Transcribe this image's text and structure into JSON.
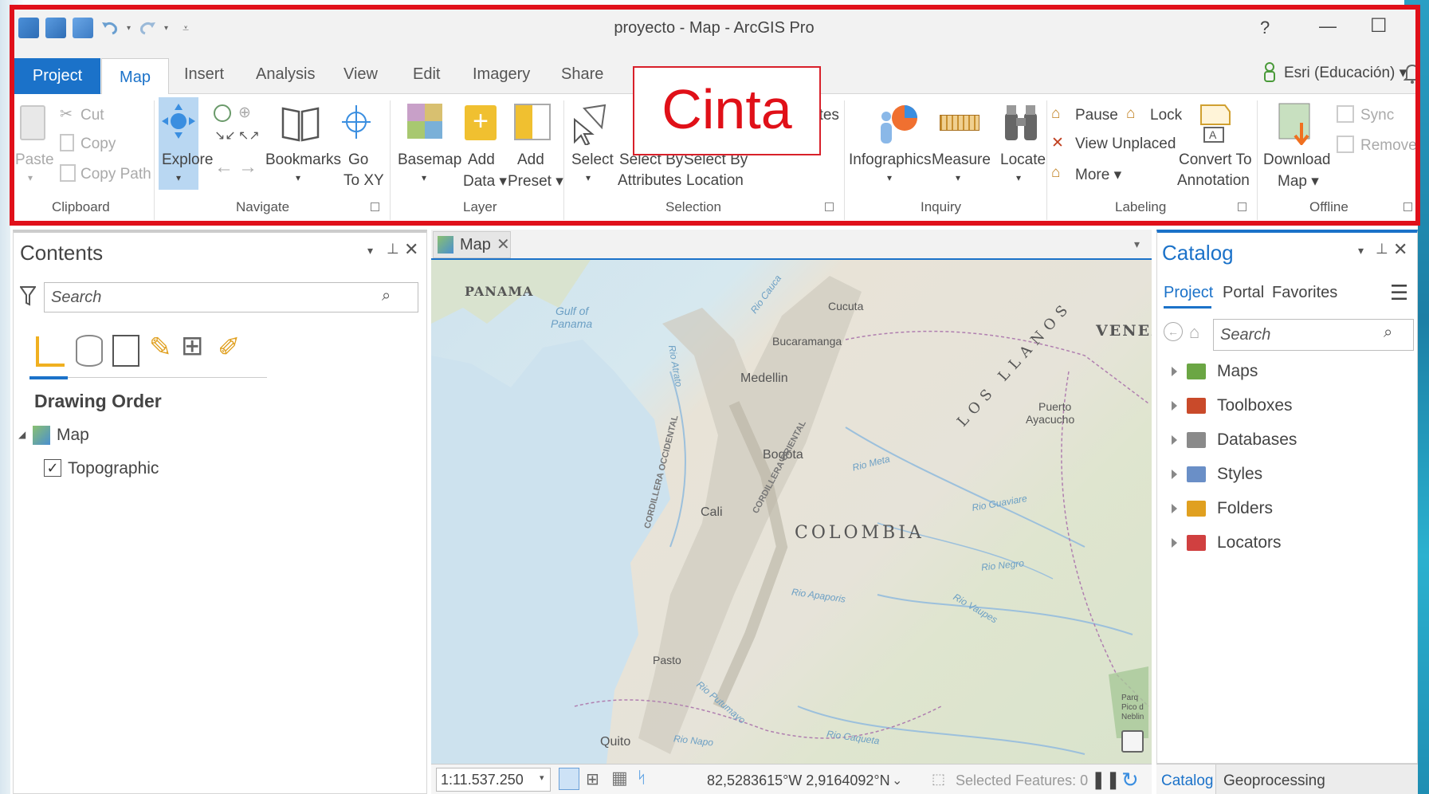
{
  "window": {
    "title": "proyecto - Map - ArcGIS Pro",
    "help_label": "?",
    "minimize_label": "—",
    "maximize_label": "☐"
  },
  "account": {
    "label": "Esri (Educación) ▾"
  },
  "tabs": {
    "project": "Project",
    "map": "Map",
    "insert": "Insert",
    "analysis": "Analysis",
    "view": "View",
    "edit": "Edit",
    "imagery": "Imagery",
    "share": "Share"
  },
  "annotation": {
    "label": "Cinta"
  },
  "ribbon": {
    "clipboard": {
      "group": "Clipboard",
      "paste": "Paste",
      "cut": "Cut",
      "copy": "Copy",
      "copy_path": "Copy Path"
    },
    "navigate": {
      "group": "Navigate",
      "explore": "Explore",
      "bookmarks": "Bookmarks",
      "go": "Go",
      "to_xy": "To XY"
    },
    "layer": {
      "group": "Layer",
      "basemap": "Basemap",
      "add": "Add",
      "data": "Data ▾",
      "add2": "Add",
      "preset": "Preset ▾"
    },
    "selection": {
      "group": "Selection",
      "select": "Select",
      "select_by": "Select By",
      "attributes": "Attributes",
      "select_by2": "Select By",
      "location": "Location",
      "partial": "utes"
    },
    "inquiry": {
      "group": "Inquiry",
      "infographics": "Infographics",
      "measure": "Measure",
      "locate": "Locate"
    },
    "labeling": {
      "group": "Labeling",
      "pause": "Pause",
      "lock": "Lock",
      "view_unplaced": "View Unplaced",
      "more": "More ▾",
      "convert_to": "Convert To",
      "annotation": "Annotation"
    },
    "offline": {
      "group": "Offline",
      "download": "Download",
      "map": "Map ▾",
      "sync": "Sync",
      "remove": "Remove"
    }
  },
  "contents": {
    "title": "Contents",
    "search_placeholder": "Search",
    "section": "Drawing Order",
    "map_item": "Map",
    "layer_item": "Topographic",
    "layer_checked": true
  },
  "map_view": {
    "tab_label": "Map",
    "labels": {
      "panama": "PANAMA",
      "gulf": "Gulf of",
      "panama_gulf": "Panama",
      "venez": "VENEZ",
      "cucuta": "Cucuta",
      "bucaramanga": "Bucaramanga",
      "medellin": "Medellin",
      "puerto": "Puerto",
      "ayacucho": "Ayacucho",
      "bogota": "Bogota",
      "cali": "Cali",
      "colombia": "COLOMBIA",
      "pasto": "Pasto",
      "quito": "Quito",
      "los_llanos": "LOS  LLANOS",
      "cordillera_occ": "CORDILLERA OCCIDENTAL",
      "cordillera_ori": "CORDILLERA ORIENTAL",
      "rio_meta": "Rio Meta",
      "rio_guaviare": "Rio Guaviare",
      "rio_negro": "Rio Negro",
      "rio_apaporis": "Rio Apaporis",
      "rio_vaupes": "Rio Vaupes",
      "rio_caqueta": "Rio Caqueta",
      "rio_putumayo": "Rio Putumayo",
      "rio_napo": "Rio Napo",
      "rio_cauca": "Rio Cauca",
      "rio_atrato": "Rio Atrato",
      "park": "Parq\nPico d\nNeblin"
    }
  },
  "statusbar": {
    "scale": "1:11.537.250",
    "coordinates": "82,5283615°W 2,9164092°N",
    "selected": "Selected Features: 0"
  },
  "catalog": {
    "title": "Catalog",
    "tabs": [
      "Project",
      "Portal",
      "Favorites"
    ],
    "search_placeholder": "Search",
    "items": [
      {
        "label": "Maps",
        "icon": "maps-folder-icon",
        "color": "#6ba644"
      },
      {
        "label": "Toolboxes",
        "icon": "toolboxes-folder-icon",
        "color": "#c94a2a"
      },
      {
        "label": "Databases",
        "icon": "databases-folder-icon",
        "color": "#8a8a8a"
      },
      {
        "label": "Styles",
        "icon": "styles-folder-icon",
        "color": "#6a8fc7"
      },
      {
        "label": "Folders",
        "icon": "folders-folder-icon",
        "color": "#e0a020"
      },
      {
        "label": "Locators",
        "icon": "locators-folder-icon",
        "color": "#d04040"
      }
    ],
    "bottom_tabs": {
      "catalog": "Catalog",
      "geoprocessing": "Geoprocessing"
    }
  },
  "colors": {
    "accent": "#1b72c9",
    "annotation_red": "#e0101a"
  }
}
